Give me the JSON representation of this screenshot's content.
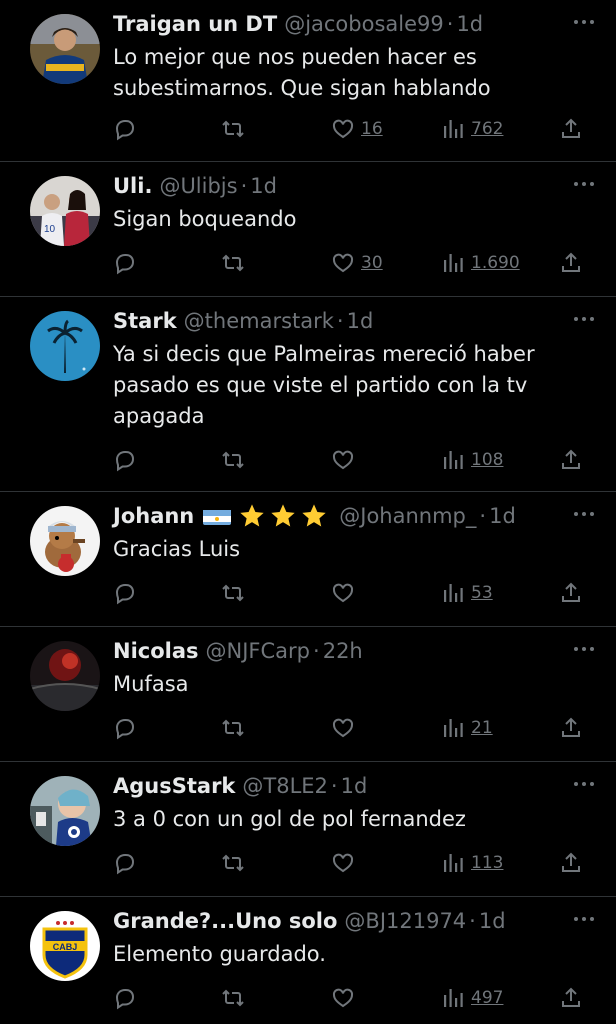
{
  "icons": {
    "reply": "reply-icon",
    "retweet": "retweet-icon",
    "like": "heart-icon",
    "views": "views-icon",
    "share": "share-icon",
    "more": "more-icon"
  },
  "tweets": [
    {
      "name": "Traigan un DT",
      "handle": "@jacobosale99",
      "dot": "·",
      "time": "1d",
      "text": [
        "Lo mejor que nos pueden hacer es",
        "subestimarnos. Que sigan hablando"
      ],
      "likes": "16",
      "views": "762"
    },
    {
      "name": "Uli.",
      "handle": "@Ulibjs",
      "dot": "·",
      "time": "1d",
      "text": [
        "Sigan boqueando"
      ],
      "likes": "30",
      "views": "1.690"
    },
    {
      "name": "Stark",
      "handle": "@themarstark",
      "dot": "·",
      "time": "1d",
      "text": [
        "Ya si decis que Palmeiras mereció haber",
        "pasado es que viste el partido con la tv",
        "apagada"
      ],
      "likes": "",
      "views": "108"
    },
    {
      "name": "Johann",
      "handle": "@Johannmp_",
      "dot": "·",
      "time": "1d",
      "text": [
        "Gracias Luis"
      ],
      "likes": "",
      "views": "53"
    },
    {
      "name": "Nicolas",
      "handle": "@NJFCarp",
      "dot": "·",
      "time": "22h",
      "text": [
        "Mufasa"
      ],
      "likes": "",
      "views": "21"
    },
    {
      "name": "AgusStark",
      "handle": "@T8LE2",
      "dot": "·",
      "time": "1d",
      "text": [
        "3 a 0 con un gol de pol fernandez"
      ],
      "likes": "",
      "views": "113"
    },
    {
      "name": "Grande?...Uno solo",
      "handle": "@BJ121974",
      "dot": "·",
      "time": "1d",
      "text": [
        "Elemento guardado."
      ],
      "likes": "",
      "views": "497"
    }
  ],
  "avatar_badge": "CABJ",
  "colors": {
    "background": "#000000",
    "text": "#e7e9ea",
    "muted": "#71767b",
    "divider": "#2f3336"
  }
}
